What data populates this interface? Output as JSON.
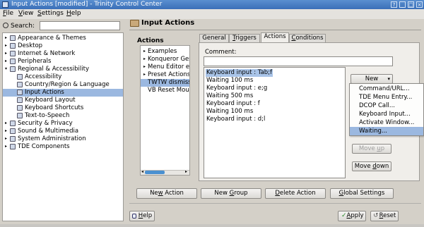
{
  "window": {
    "title": "Input Actions [modified] - Trinity Control Center",
    "titlebar_color": "#3a6fb8",
    "controls": [
      "?",
      "_",
      "□",
      "×"
    ]
  },
  "menubar": {
    "items": [
      {
        "label": "File",
        "accel": "F",
        "rest": "ile"
      },
      {
        "label": "View",
        "accel": "V",
        "rest": "iew"
      },
      {
        "label": "Settings",
        "accel": "S",
        "rest": "ettings"
      },
      {
        "label": "Help",
        "accel": "H",
        "rest": "elp"
      }
    ]
  },
  "search": {
    "label": "Search:",
    "value": ""
  },
  "tree": {
    "items": [
      {
        "label": "Appearance & Themes",
        "expand": "▸",
        "selected": false,
        "child": false
      },
      {
        "label": "Desktop",
        "expand": "▸",
        "selected": false,
        "child": false
      },
      {
        "label": "Internet & Network",
        "expand": "▸",
        "selected": false,
        "child": false
      },
      {
        "label": "Peripherals",
        "expand": "▸",
        "selected": false,
        "child": false
      },
      {
        "label": "Regional & Accessibility",
        "expand": "▾",
        "selected": false,
        "child": false
      },
      {
        "label": "Accessibility",
        "expand": "",
        "selected": false,
        "child": true
      },
      {
        "label": "Country/Region & Language",
        "expand": "",
        "selected": false,
        "child": true
      },
      {
        "label": "Input Actions",
        "expand": "",
        "selected": true,
        "child": true
      },
      {
        "label": "Keyboard Layout",
        "expand": "",
        "selected": false,
        "child": true
      },
      {
        "label": "Keyboard Shortcuts",
        "expand": "",
        "selected": false,
        "child": true
      },
      {
        "label": "Text-to-Speech",
        "expand": "",
        "selected": false,
        "child": true
      },
      {
        "label": "Security & Privacy",
        "expand": "▸",
        "selected": false,
        "child": false
      },
      {
        "label": "Sound & Multimedia",
        "expand": "▸",
        "selected": false,
        "child": false
      },
      {
        "label": "System Administration",
        "expand": "▸",
        "selected": false,
        "child": false
      },
      {
        "label": "TDE Components",
        "expand": "▸",
        "selected": false,
        "child": false
      }
    ]
  },
  "header": {
    "title": "Input Actions"
  },
  "actions_panel": {
    "label": "Actions",
    "items": [
      {
        "label": "Examples",
        "arrow": "▸",
        "selected": false
      },
      {
        "label": "Konqueror Ges",
        "arrow": "▸",
        "selected": false
      },
      {
        "label": "Menu Editor en",
        "arrow": "▸",
        "selected": false
      },
      {
        "label": "Preset Actions",
        "arrow": "▸",
        "selected": false
      },
      {
        "label": "TWTW dismiss",
        "arrow": "",
        "selected": true
      },
      {
        "label": "VB Reset Mous",
        "arrow": "",
        "selected": false
      }
    ]
  },
  "tabs": [
    {
      "label": "General",
      "accel": "",
      "pre": "General",
      "rest": "",
      "active": false
    },
    {
      "label": "Triggers",
      "accel": "T",
      "pre": "",
      "rest": "riggers",
      "active": false
    },
    {
      "label": "Actions",
      "accel": "",
      "pre": "Actions",
      "rest": "",
      "active": true
    },
    {
      "label": "Conditions",
      "accel": "C",
      "pre": "",
      "rest": "onditions",
      "active": false
    }
  ],
  "comment": {
    "label": "Comment:",
    "value": ""
  },
  "action_list": [
    {
      "text": "Keyboard input : Tab;f",
      "selected": true
    },
    {
      "text": "Waiting 100 ms",
      "selected": false
    },
    {
      "text": "Keyboard input : e;g",
      "selected": false
    },
    {
      "text": "Waiting 500 ms",
      "selected": false
    },
    {
      "text": "Keyboard input : f",
      "selected": false
    },
    {
      "text": "Waiting 100 ms",
      "selected": false
    },
    {
      "text": "Keyboard input : d;l",
      "selected": false
    }
  ],
  "new_button": {
    "label": "New",
    "arrow": "▾"
  },
  "popup_menu": [
    {
      "label": "Command/URL...",
      "selected": false
    },
    {
      "label": "TDE Menu Entry...",
      "selected": false
    },
    {
      "label": "DCOP Call...",
      "selected": false
    },
    {
      "label": "Keyboard Input...",
      "selected": false
    },
    {
      "label": "Activate Window...",
      "selected": false
    },
    {
      "label": "Waiting...",
      "selected": true
    }
  ],
  "move_buttons": {
    "up": {
      "pre": "Move ",
      "accel": "u",
      "rest": "p",
      "enabled": false
    },
    "down": {
      "pre": "Move ",
      "accel": "d",
      "rest": "own",
      "enabled": true
    }
  },
  "bottom_buttons": {
    "new_action": {
      "pre": "Ne",
      "accel": "w",
      "rest": " Action"
    },
    "new_group": {
      "pre": "New ",
      "accel": "G",
      "rest": "roup"
    },
    "delete_action": {
      "pre": "",
      "accel": "D",
      "rest": "elete Action"
    },
    "global_settings": {
      "pre": "",
      "accel": "G",
      "rest": "lobal Settings"
    }
  },
  "footer": {
    "help": {
      "pre": "",
      "accel": "H",
      "rest": "elp"
    },
    "apply": {
      "pre": "",
      "accel": "A",
      "rest": "pply"
    },
    "reset": {
      "pre": "",
      "accel": "R",
      "rest": "eset"
    }
  },
  "colors": {
    "selection": "#9bb8e0",
    "window_bg": "#d4d0c8"
  }
}
